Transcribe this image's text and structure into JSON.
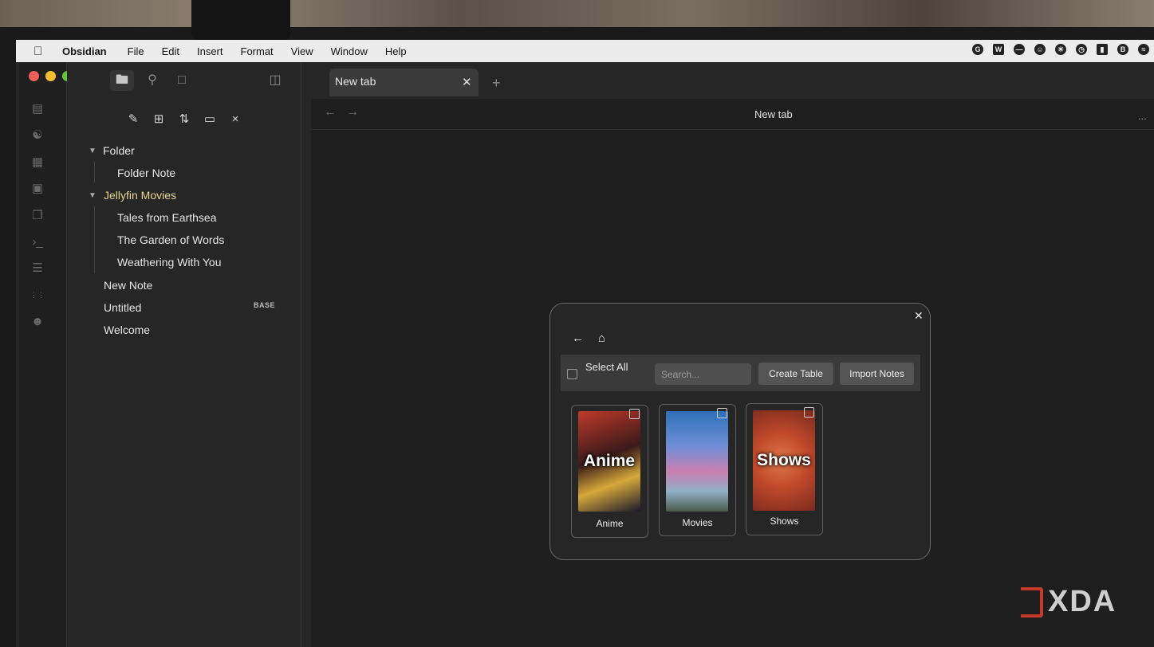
{
  "menubar": {
    "app_name": "Obsidian",
    "items": [
      "File",
      "Edit",
      "Insert",
      "Format",
      "View",
      "Window",
      "Help"
    ],
    "status_icons": [
      "grammarly-icon",
      "word-icon",
      "menu-extra-icon",
      "user-icon",
      "brightness-icon",
      "timer-icon",
      "battery-icon",
      "bluetooth-icon",
      "wifi-icon"
    ]
  },
  "ribbon": {
    "icons": [
      "file-icon",
      "graph-icon",
      "canvas-icon",
      "calendar-icon",
      "copy-icon",
      "terminal-icon",
      "list-icon",
      "base-icon",
      "plugin-icon"
    ]
  },
  "sidebar": {
    "tabs": [
      "files-icon",
      "search-icon",
      "bookmark-icon"
    ],
    "toolbar": [
      "new-note-icon",
      "new-folder-icon",
      "sort-icon",
      "auto-reveal-icon",
      "collapse-icon"
    ],
    "tree": [
      {
        "label": "Folder",
        "type": "folder"
      },
      {
        "label": "Folder Note",
        "type": "file"
      },
      {
        "label": "Jellyfin Movies",
        "type": "folder"
      },
      {
        "label": "Tales from Earthsea",
        "type": "file"
      },
      {
        "label": "The Garden of Words",
        "type": "file"
      },
      {
        "label": "Weathering With You",
        "type": "file"
      },
      {
        "label": "New Note",
        "type": "file"
      },
      {
        "label": "Untitled",
        "type": "file",
        "badge": "BASE"
      },
      {
        "label": "Welcome",
        "type": "file"
      }
    ]
  },
  "tabs": {
    "active_tab": "New tab",
    "view_title": "New tab",
    "more": "..."
  },
  "modal": {
    "select_all": "Select All",
    "search_placeholder": "Search...",
    "create_table": "Create Table",
    "import_notes": "Import Notes",
    "cards": [
      {
        "label": "Anime",
        "poster_text": "Anime",
        "colors": [
          "#c0392b",
          "#1a1a2a"
        ]
      },
      {
        "label": "Movies",
        "poster_text": "",
        "colors": [
          "#2f6fb5",
          "#c97fb0"
        ]
      },
      {
        "label": "Shows",
        "poster_text": "Shows",
        "colors": [
          "#c0492b",
          "#7a2a1f"
        ]
      }
    ]
  },
  "watermark": {
    "text": "XDA"
  },
  "colors": {
    "accent_folder": "#e8d690",
    "xda_red": "#c63b2b"
  }
}
